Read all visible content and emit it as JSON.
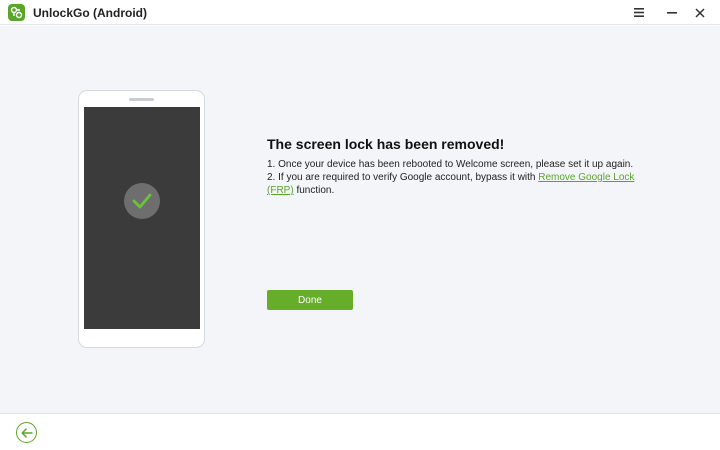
{
  "window": {
    "title": "UnlockGo (Android)",
    "controls": {
      "menu_icon": "hamburger-menu-icon",
      "minimize_icon": "minimize-icon",
      "close_icon": "close-icon"
    }
  },
  "phone": {
    "status_icon": "checkmark-icon"
  },
  "result": {
    "heading": "The screen lock has been removed!",
    "step1": "1. Once your device has been rebooted to Welcome screen, please set it up again.",
    "step2_prefix": "2. If you are required to verify Google account, bypass it with ",
    "step2_link": "Remove Google Lock (FRP)",
    "step2_suffix": " function."
  },
  "actions": {
    "done_label": "Done"
  },
  "footer": {
    "back_icon": "back-arrow-icon"
  },
  "colors": {
    "accent": "#66ad2a",
    "link": "#5aa52a",
    "background": "#f4f5f9",
    "phone_screen": "#3b3b3b"
  }
}
